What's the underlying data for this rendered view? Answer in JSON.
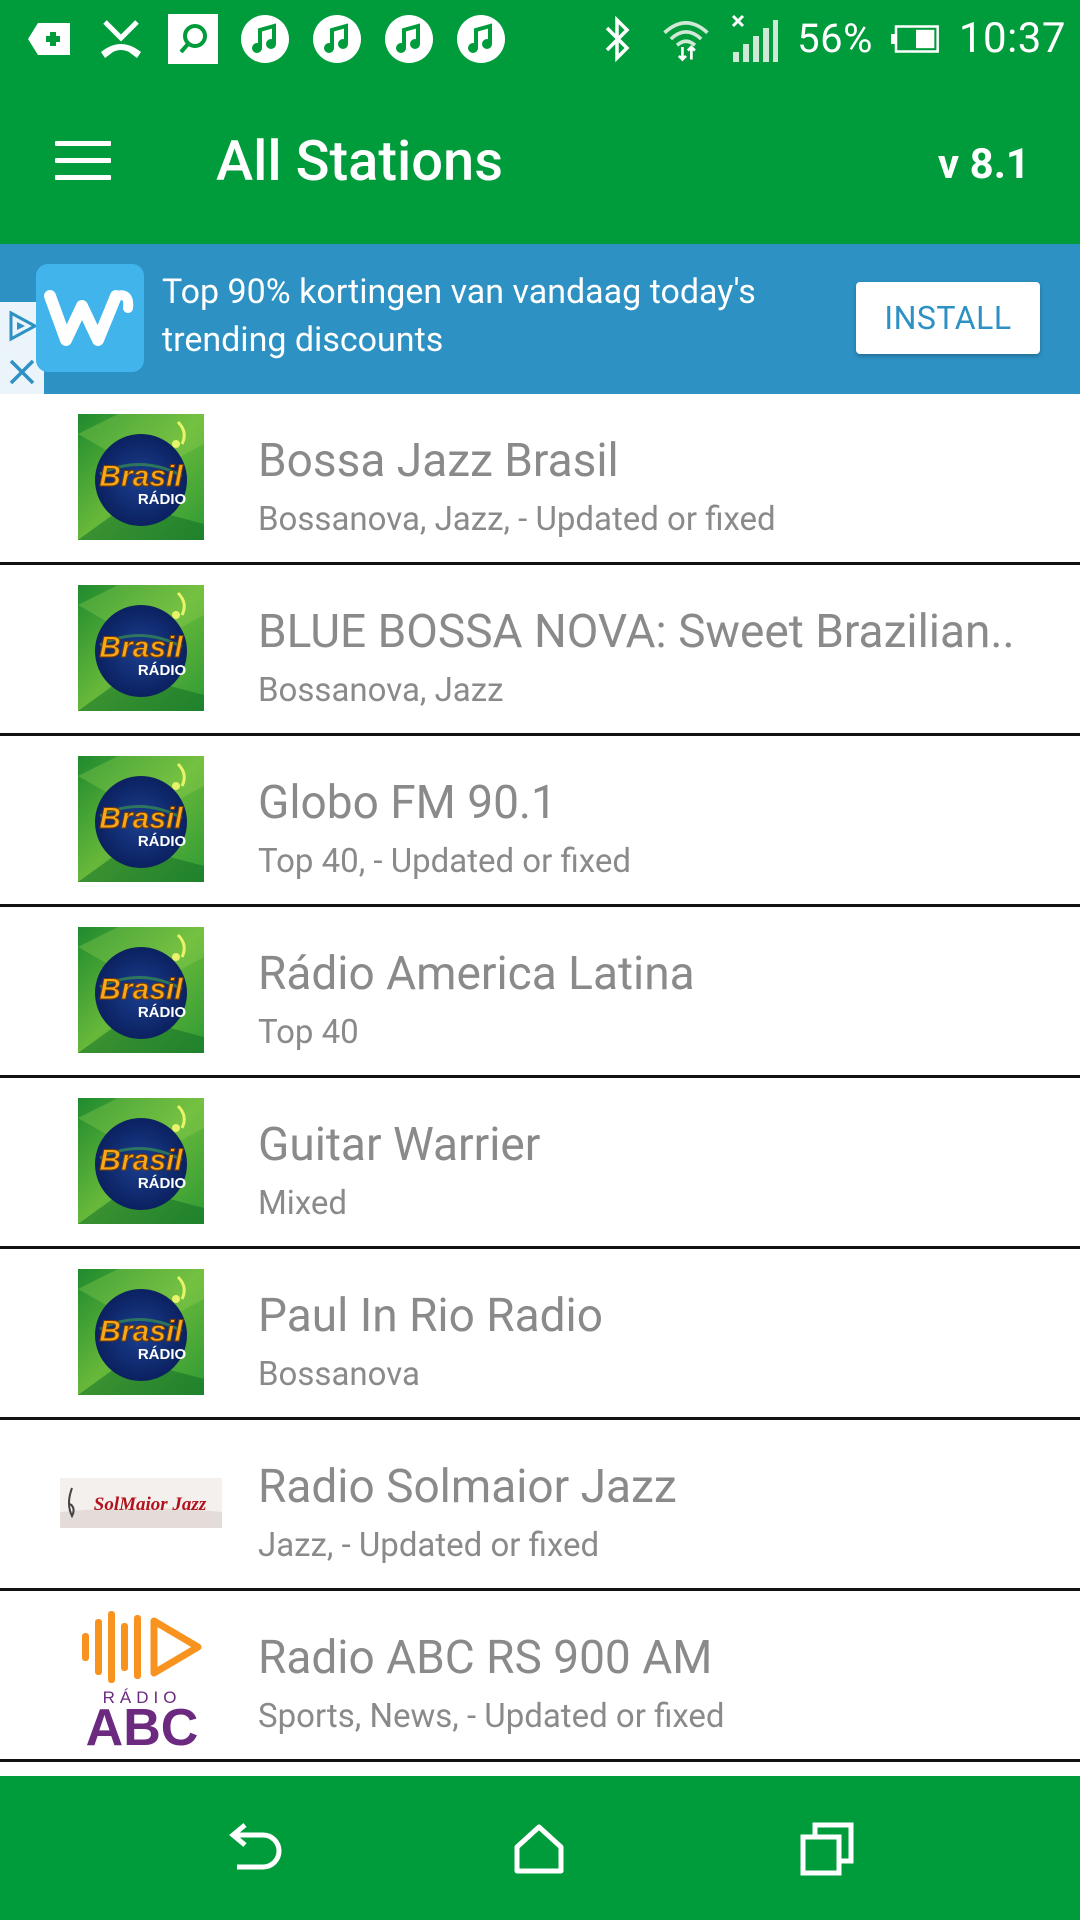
{
  "status_bar": {
    "battery_percent": "56%",
    "time": "10:37",
    "icons": [
      "add-icon",
      "missed-call-icon",
      "search-app-icon",
      "music-note-icon",
      "music-note-icon",
      "music-note-icon",
      "music-note-icon",
      "bluetooth-icon",
      "wifi-icon",
      "signal-icon",
      "battery-icon"
    ]
  },
  "app_bar": {
    "title": "All Stations",
    "version": "v 8.1",
    "menu_icon": "hamburger-menu-icon"
  },
  "ad": {
    "text": "Top 90% kortingen van vandaag today's trending discounts",
    "button_label": "INSTALL",
    "logo_letter": "w"
  },
  "stations": [
    {
      "name": "Bossa Jazz Brasil",
      "genre": "Bossanova, Jazz, - Updated or fixed",
      "logo": "brasil-radio-logo"
    },
    {
      "name": "BLUE BOSSA NOVA: Sweet Brazilian..",
      "genre": "Bossanova, Jazz",
      "logo": "brasil-radio-logo"
    },
    {
      "name": "Globo FM 90.1",
      "genre": "Top 40, - Updated or fixed",
      "logo": "brasil-radio-logo"
    },
    {
      "name": "Rádio America Latina",
      "genre": "Top 40",
      "logo": "brasil-radio-logo"
    },
    {
      "name": "Guitar Warrier",
      "genre": "Mixed",
      "logo": "brasil-radio-logo"
    },
    {
      "name": "Paul In Rio Radio",
      "genre": "Bossanova",
      "logo": "brasil-radio-logo"
    },
    {
      "name": "Radio Solmaior Jazz",
      "genre": "Jazz, - Updated or fixed",
      "logo": "solmaior-jazz-logo"
    },
    {
      "name": "Radio ABC RS 900 AM",
      "genre": "Sports, News, - Updated or fixed",
      "logo": "radio-abc-logo"
    }
  ],
  "logo_text": {
    "brasil": "Brasil",
    "radio": "RÁDIO",
    "solmaior": "SolMaior Jazz",
    "abc_radio": "RÁDIO",
    "abc": "ABC"
  },
  "colors": {
    "primary_green": "#009c3b",
    "ad_blue": "#2e91c4",
    "text_gray": "#8a8a8a"
  }
}
